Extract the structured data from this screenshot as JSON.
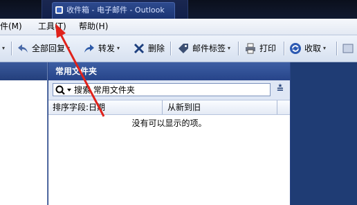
{
  "window": {
    "tab_title": "收件箱 - 电子邮件 - Outlook"
  },
  "menu": {
    "items": [
      {
        "label": "件(M)"
      },
      {
        "label": "工具(T)"
      },
      {
        "label": "帮助(H)"
      }
    ]
  },
  "toolbar": {
    "reply_all": "全部回复",
    "forward": "转发",
    "delete": "删除",
    "mail_tag": "邮件标签",
    "print": "打印",
    "send_receive": "收取"
  },
  "folder_pane": {
    "title": "常用文件夹",
    "search_placeholder": "搜索 常用文件夹",
    "sort_field": "排序字段:日期",
    "sort_order": "从新到旧",
    "empty_message": "没有可以显示的项。"
  },
  "colors": {
    "accent": "#2a4585",
    "annotation_arrow": "#e0221b"
  }
}
